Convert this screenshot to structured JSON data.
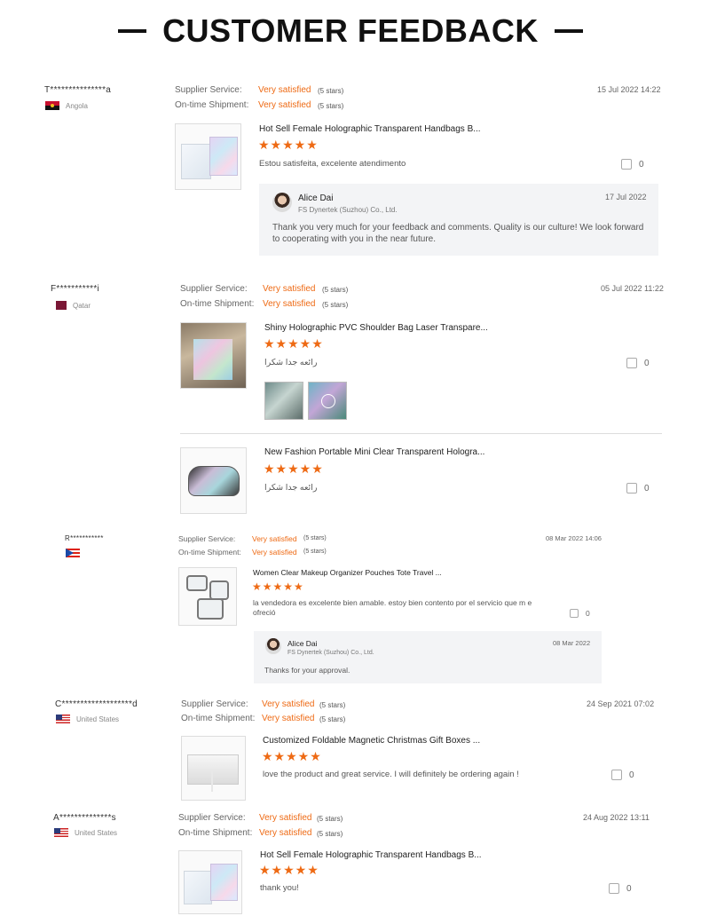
{
  "header": {
    "title": "CUSTOMER FEEDBACK"
  },
  "labels": {
    "supplier": "Supplier Service:",
    "shipment": "On-time Shipment:"
  },
  "reviews": [
    {
      "user": "T***************a",
      "country": "Angola",
      "flag": "angola-flag",
      "service": "Very satisfied",
      "service_stars": "(5 stars)",
      "shipment": "Very satisfied",
      "shipment_stars": "(5 stars)",
      "date": "15 Jul 2022 14:22",
      "product": "Hot Sell Female Holographic Transparent Handbags B...",
      "stars": "★★★★★",
      "comment": "Estou satisfeita, excelente atendimento",
      "likes": "0",
      "reply": {
        "name": "Alice Dai",
        "company": "FS Dynertek (Suzhou) Co., Ltd.",
        "date": "17 Jul 2022",
        "text": "Thank you very much for your feedback and comments. Quality is our culture! We look forward to cooperating with you in the near future."
      }
    },
    {
      "user": "F***********i",
      "country": "Qatar",
      "flag": "qatar-flag",
      "service": "Very satisfied",
      "service_stars": "(5 stars)",
      "shipment": "Very satisfied",
      "shipment_stars": "(5 stars)",
      "date": "05 Jul 2022 11:22",
      "product": "Shiny Holographic PVC Shoulder Bag Laser Transpare...",
      "stars": "★★★★★",
      "comment": "رائعه جدا شكرا",
      "likes": "0",
      "product2": "New Fashion Portable Mini Clear Transparent Hologra...",
      "stars2": "★★★★★",
      "comment2": "رائعه جدا شكرا",
      "likes2": "0"
    },
    {
      "user": "R***********",
      "country": "",
      "flag": "puerto-rico-flag",
      "service": "Very satisfied",
      "service_stars": "(5 stars)",
      "shipment": "Very satisfied",
      "shipment_stars": "(5 stars)",
      "date": "08 Mar 2022 14:06",
      "product": "Women Clear Makeup Organizer Pouches Tote Travel ...",
      "stars": "★★★★★",
      "comment": "la vendedora es excelente bien amable. estoy bien contento por el servicio que m e ofreció",
      "likes": "0",
      "reply": {
        "name": "Alice Dai",
        "company": "FS Dynertek (Suzhou) Co., Ltd.",
        "date": "08 Mar 2022",
        "text": "Thanks for your approval."
      }
    },
    {
      "user": "C*******************d",
      "country": "United States",
      "flag": "us-flag",
      "service": "Very satisfied",
      "service_stars": "(5 stars)",
      "shipment": "Very satisfied",
      "shipment_stars": "(5 stars)",
      "date": "24 Sep 2021 07:02",
      "product": "Customized Foldable Magnetic Christmas Gift Boxes ...",
      "stars": "★★★★★",
      "comment": "love the product and great service. I will definitely be ordering again !",
      "likes": "0"
    },
    {
      "user": "A**************s",
      "country": "United States",
      "flag": "us-flag",
      "service": "Very satisfied",
      "service_stars": "(5 stars)",
      "shipment": "Very satisfied",
      "shipment_stars": "(5 stars)",
      "date": "24 Aug 2022 13:11",
      "product": "Hot Sell Female Holographic Transparent Handbags B...",
      "stars": "★★★★★",
      "comment": "thank you!",
      "likes": "0"
    }
  ]
}
